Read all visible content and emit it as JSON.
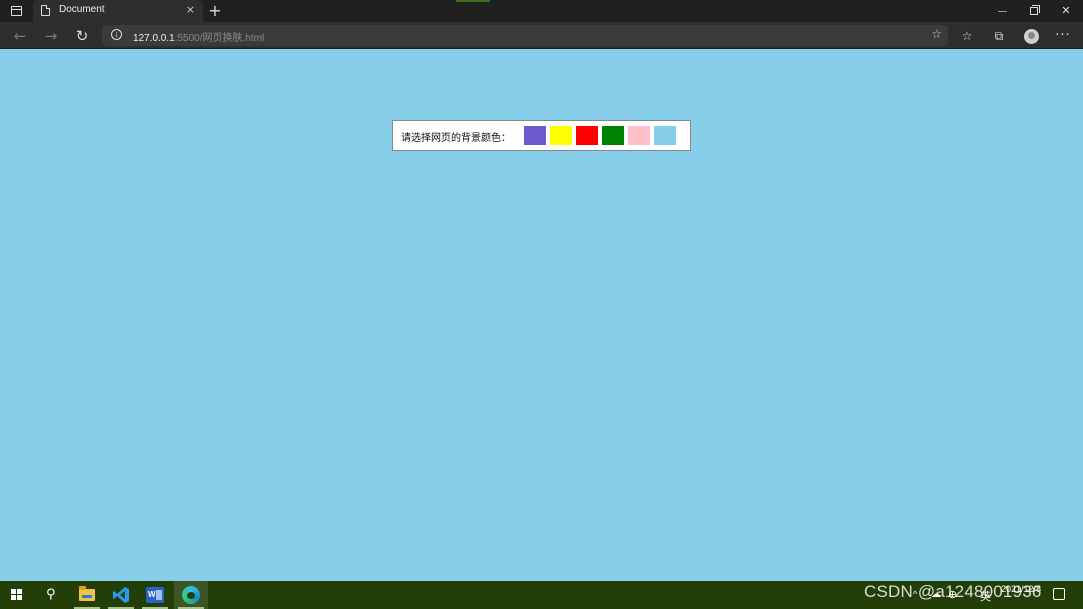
{
  "browser": {
    "tab": {
      "title": "Document",
      "close_glyph": "×",
      "icon": "page-icon"
    },
    "new_tab_glyph": "+",
    "window_controls": {
      "close_glyph": "✕"
    },
    "nav": {
      "back_glyph": "←",
      "forward_glyph": "→",
      "reload_glyph": "↻"
    },
    "address": {
      "host": "127.0.0.1",
      "path": ":5500/网页换肤.html",
      "info_glyph": "i"
    },
    "toolbar": {
      "favorite_glyph": "☆",
      "favorites_glyph": "☆",
      "collections_glyph": "⧉",
      "more_glyph": "···"
    }
  },
  "page": {
    "background_color": "#87ceeb",
    "picker": {
      "label": "请选择网页的背景颜色：",
      "swatches": [
        {
          "name": "slateblue",
          "color": "#6a5acd"
        },
        {
          "name": "yellow",
          "color": "#ffff00"
        },
        {
          "name": "red",
          "color": "#ff0000"
        },
        {
          "name": "green",
          "color": "#008000"
        },
        {
          "name": "pink",
          "color": "#ffc0cb"
        },
        {
          "name": "skyblue",
          "color": "#87ceeb"
        }
      ]
    }
  },
  "taskbar": {
    "background_color": "#233e06",
    "search_glyph": "⚲",
    "apps": [
      {
        "name": "file-explorer",
        "active": false
      },
      {
        "name": "vscode",
        "active": false
      },
      {
        "name": "word",
        "label": "W",
        "active": false
      },
      {
        "name": "edge",
        "active": true
      }
    ],
    "tray": {
      "arrow_glyph": "^",
      "ime": "英",
      "network_glyph": "⊕",
      "cloud_glyph": "☁"
    },
    "clock": {
      "time": "",
      "date": "2021/12/8"
    }
  },
  "watermark": "CSDN @a1248001936"
}
